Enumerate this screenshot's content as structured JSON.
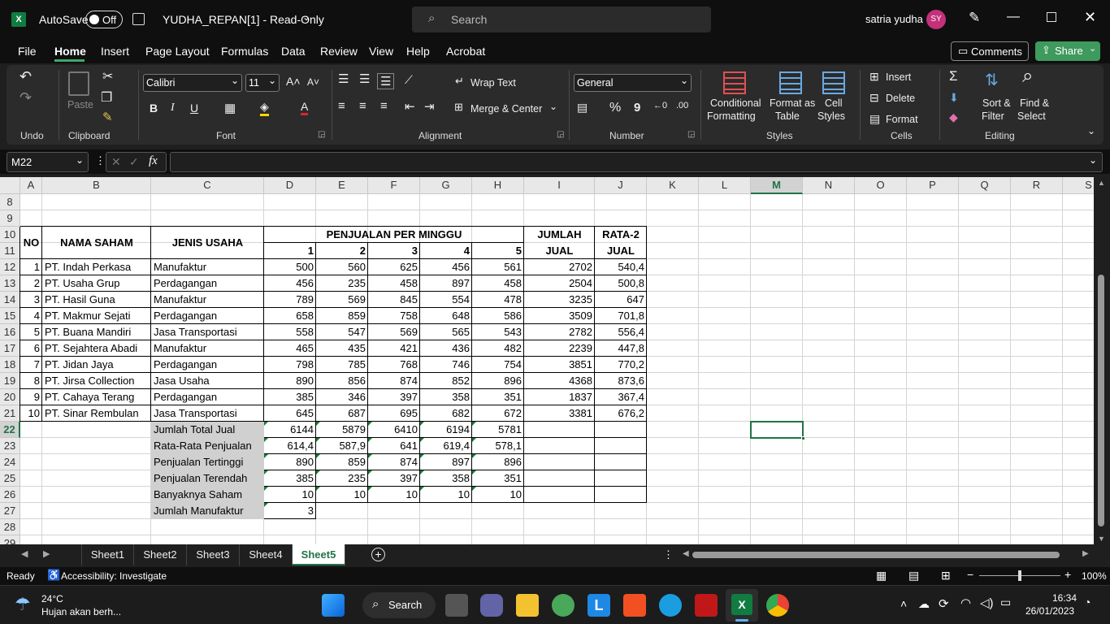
{
  "title_bar": {
    "autosave": "AutoSave",
    "toggle": "Off",
    "filename": "YUDHA_REPAN[1]  -  Read-Only",
    "search_placeholder": "Search",
    "user": "satria yudha",
    "initials": "SY"
  },
  "menu": [
    "File",
    "Home",
    "Insert",
    "Page Layout",
    "Formulas",
    "Data",
    "Review",
    "View",
    "Help",
    "Acrobat"
  ],
  "comments_btn": "Comments",
  "share_btn": "Share",
  "ribbon": {
    "undo": "Undo",
    "paste": "Paste",
    "clipboard": "Clipboard",
    "font_name": "Calibri",
    "font_size": "11",
    "font": "Font",
    "wrap": "Wrap Text",
    "merge": "Merge & Center",
    "alignment": "Alignment",
    "numfmt": "General",
    "number": "Number",
    "cond1": "Conditional",
    "cond2": "Formatting",
    "fmt1": "Format as",
    "fmt2": "Table",
    "cs1": "Cell",
    "cs2": "Styles",
    "styles": "Styles",
    "insert": "Insert",
    "delete": "Delete",
    "format": "Format",
    "cells": "Cells",
    "sort1": "Sort &",
    "sort2": "Filter",
    "find1": "Find &",
    "find2": "Select",
    "editing": "Editing",
    "bold": "B",
    "italic": "I",
    "underline": "U",
    "pct": "%",
    "comma": "9"
  },
  "namebox": "M22",
  "columns": [
    "A",
    "B",
    "C",
    "D",
    "E",
    "F",
    "G",
    "H",
    "I",
    "J",
    "K",
    "L",
    "M",
    "N",
    "O",
    "P",
    "Q",
    "R",
    "S"
  ],
  "rows": [
    "8",
    "9",
    "10",
    "11",
    "12",
    "13",
    "14",
    "15",
    "16",
    "17",
    "18",
    "19",
    "20",
    "21",
    "22",
    "23",
    "24",
    "25",
    "26",
    "27",
    "28",
    "29"
  ],
  "headers": {
    "no": "NO",
    "nama": "NAMA SAHAM",
    "jenis": "JENIS USAHA",
    "penjualan": "PENJUALAN PER MINGGU",
    "jumlah1": "JUMLAH",
    "jumlah2": "JUAL",
    "rata1": "RATA-2",
    "rata2": "JUAL",
    "weeks": [
      "1",
      "2",
      "3",
      "4",
      "5"
    ]
  },
  "data": [
    [
      "1",
      "PT. Indah Perkasa",
      "Manufaktur",
      "500",
      "560",
      "625",
      "456",
      "561",
      "2702",
      "540,4"
    ],
    [
      "2",
      "PT. Usaha Grup",
      "Perdagangan",
      "456",
      "235",
      "458",
      "897",
      "458",
      "2504",
      "500,8"
    ],
    [
      "3",
      "PT. Hasil Guna",
      "Manufaktur",
      "789",
      "569",
      "845",
      "554",
      "478",
      "3235",
      "647"
    ],
    [
      "4",
      "PT. Makmur Sejati",
      "Perdagangan",
      "658",
      "859",
      "758",
      "648",
      "586",
      "3509",
      "701,8"
    ],
    [
      "5",
      "PT. Buana Mandiri",
      "Jasa Transportasi",
      "558",
      "547",
      "569",
      "565",
      "543",
      "2782",
      "556,4"
    ],
    [
      "6",
      "PT. Sejahtera Abadi",
      "Manufaktur",
      "465",
      "435",
      "421",
      "436",
      "482",
      "2239",
      "447,8"
    ],
    [
      "7",
      "PT. Jidan Jaya",
      "Perdagangan",
      "798",
      "785",
      "768",
      "746",
      "754",
      "3851",
      "770,2"
    ],
    [
      "8",
      "PT. Jirsa Collection",
      "Jasa Usaha",
      "890",
      "856",
      "874",
      "852",
      "896",
      "4368",
      "873,6"
    ],
    [
      "9",
      "PT. Cahaya Terang",
      "Perdagangan",
      "385",
      "346",
      "397",
      "358",
      "351",
      "1837",
      "367,4"
    ],
    [
      "10",
      "PT. Sinar Rembulan",
      "Jasa Transportasi",
      "645",
      "687",
      "695",
      "682",
      "672",
      "3381",
      "676,2"
    ]
  ],
  "summary": [
    [
      "Jumlah Total Jual",
      "6144",
      "5879",
      "6410",
      "6194",
      "5781"
    ],
    [
      "Rata-Rata Penjualan",
      "614,4",
      "587,9",
      "641",
      "619,4",
      "578,1"
    ],
    [
      "Penjualan Tertinggi",
      "890",
      "859",
      "874",
      "897",
      "896"
    ],
    [
      "Penjualan Terendah",
      "385",
      "235",
      "397",
      "358",
      "351"
    ],
    [
      "Banyaknya Saham",
      "10",
      "10",
      "10",
      "10",
      "10"
    ],
    [
      "Jumlah Manufaktur",
      "3"
    ]
  ],
  "sheets": [
    "Sheet1",
    "Sheet2",
    "Sheet3",
    "Sheet4",
    "Sheet5"
  ],
  "status": {
    "ready": "Ready",
    "access": "Accessibility: Investigate",
    "zoom": "100%"
  },
  "taskbar": {
    "temp": "24°C",
    "weather": "Hujan akan berh...",
    "search": "Search",
    "time": "16:34",
    "date": "26/01/2023"
  }
}
